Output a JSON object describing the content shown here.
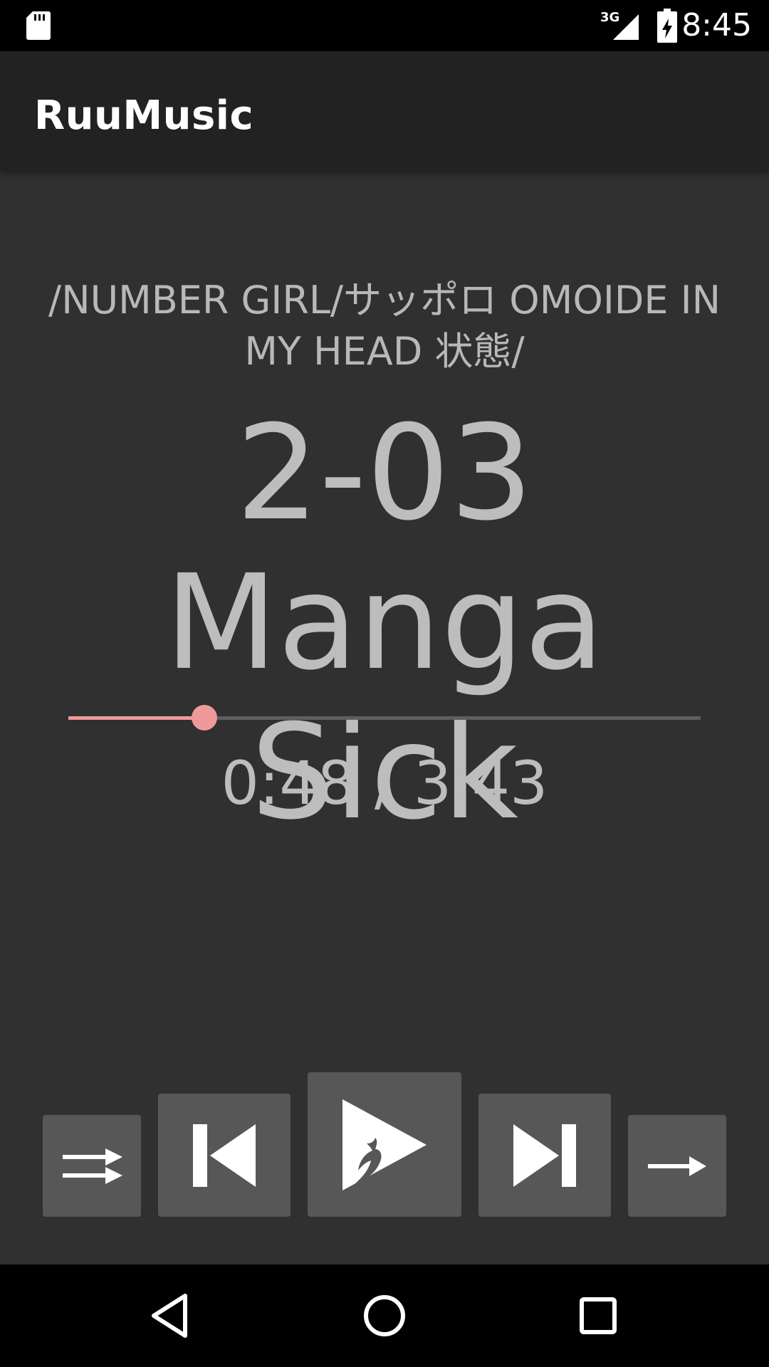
{
  "status_bar": {
    "time": "8:45",
    "network_label": "3G",
    "icons": [
      "sd-card-icon",
      "cell-signal-icon",
      "battery-charging-icon"
    ]
  },
  "app_bar": {
    "title": "RuuMusic"
  },
  "now_playing": {
    "path": "/NUMBER GIRL/サッポロ OMOIDE IN MY HEAD 状態/",
    "title": "2-03 Manga Sick",
    "position": "0:48",
    "duration": "3:43",
    "time_display": "0:48 / 3:43",
    "progress_fraction": 0.215
  },
  "controls": {
    "shuffle_icon": "shuffle-icon",
    "previous_icon": "skip-previous-icon",
    "play_icon": "play-icon",
    "next_icon": "skip-next-icon",
    "repeat_icon": "repeat-off-icon"
  },
  "navigation_bar": {
    "icons": [
      "back-icon",
      "home-icon",
      "recents-icon"
    ]
  },
  "colors": {
    "background": "#303030",
    "app_bar": "#222222",
    "accent": "#ef9a9a",
    "button": "#575757",
    "text": "#bdbdbd"
  }
}
